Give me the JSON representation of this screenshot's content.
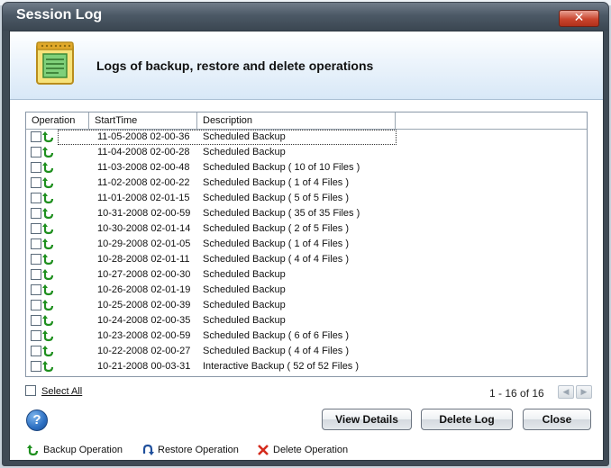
{
  "window": {
    "title": "Session Log",
    "close_label": "✕"
  },
  "banner": {
    "heading": "Logs of backup, restore and delete operations",
    "icon": "log-notepad-icon"
  },
  "grid": {
    "columns": [
      "Operation",
      "StartTime",
      "Description"
    ],
    "rows": [
      {
        "operation": "backup",
        "start_time": "11-05-2008 02-00-36",
        "description": "Scheduled  Backup"
      },
      {
        "operation": "backup",
        "start_time": "11-04-2008 02-00-28",
        "description": "Scheduled  Backup"
      },
      {
        "operation": "backup",
        "start_time": "11-03-2008 02-00-48",
        "description": "Scheduled  Backup ( 10 of 10 Files )"
      },
      {
        "operation": "backup",
        "start_time": "11-02-2008 02-00-22",
        "description": "Scheduled  Backup ( 1 of 4 Files )"
      },
      {
        "operation": "backup",
        "start_time": "11-01-2008 02-01-15",
        "description": "Scheduled  Backup ( 5 of 5 Files )"
      },
      {
        "operation": "backup",
        "start_time": "10-31-2008 02-00-59",
        "description": "Scheduled  Backup ( 35 of 35 Files )"
      },
      {
        "operation": "backup",
        "start_time": "10-30-2008 02-01-14",
        "description": "Scheduled  Backup ( 2 of 5 Files )"
      },
      {
        "operation": "backup",
        "start_time": "10-29-2008 02-01-05",
        "description": "Scheduled  Backup ( 1 of 4 Files )"
      },
      {
        "operation": "backup",
        "start_time": "10-28-2008 02-01-11",
        "description": "Scheduled  Backup ( 4 of 4 Files )"
      },
      {
        "operation": "backup",
        "start_time": "10-27-2008 02-00-30",
        "description": "Scheduled  Backup"
      },
      {
        "operation": "backup",
        "start_time": "10-26-2008 02-01-19",
        "description": "Scheduled  Backup"
      },
      {
        "operation": "backup",
        "start_time": "10-25-2008 02-00-39",
        "description": "Scheduled  Backup"
      },
      {
        "operation": "backup",
        "start_time": "10-24-2008 02-00-35",
        "description": "Scheduled  Backup"
      },
      {
        "operation": "backup",
        "start_time": "10-23-2008 02-00-59",
        "description": "Scheduled  Backup ( 6 of 6 Files )"
      },
      {
        "operation": "backup",
        "start_time": "10-22-2008 02-00-27",
        "description": "Scheduled  Backup ( 4 of 4 Files )"
      },
      {
        "operation": "backup",
        "start_time": "10-21-2008 00-03-31",
        "description": "Interactive Backup ( 52 of 52 Files )"
      }
    ]
  },
  "footer": {
    "select_all_label": "Select All",
    "pager_text": "1 - 16 of 16",
    "help_label": "?",
    "view_details_label": "View Details",
    "delete_log_label": "Delete Log",
    "close_label": "Close"
  },
  "legend": {
    "backup_label": "Backup Operation",
    "restore_label": "Restore Operation",
    "delete_label": "Delete Operation"
  },
  "colors": {
    "backup_green": "#1e8f1e",
    "restore_blue": "#1f4f9c",
    "delete_red": "#d42a1c"
  }
}
